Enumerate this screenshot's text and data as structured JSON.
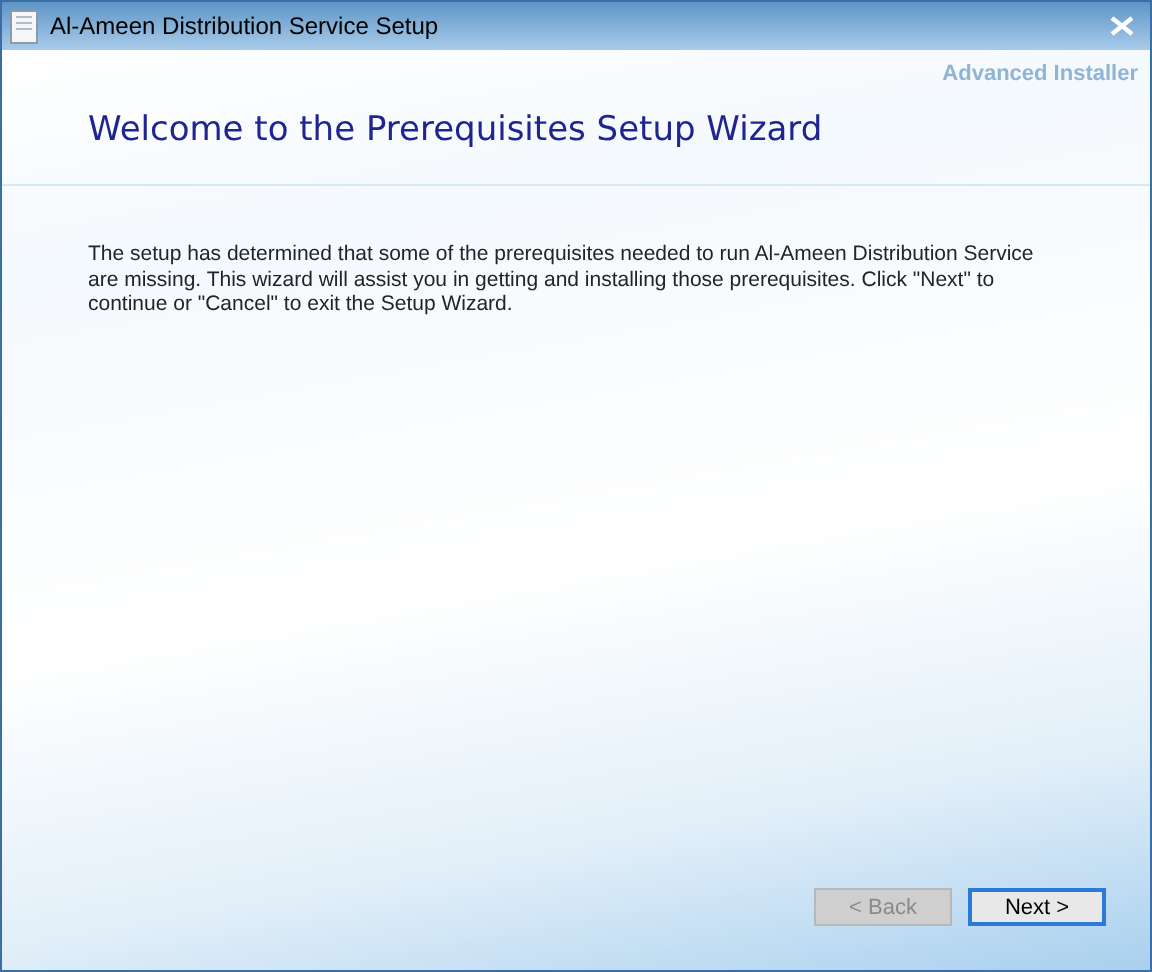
{
  "window": {
    "title": "Al-Ameen Distribution Service Setup"
  },
  "brand": "Advanced Installer",
  "heading": "Welcome to the Prerequisites Setup Wizard",
  "description": "The setup has determined that some of the prerequisites needed to run Al-Ameen Distribution Service are missing. This wizard will assist you in getting and installing those prerequisites. Click \"Next\" to continue or \"Cancel\" to exit the Setup Wizard.",
  "buttons": [
    {
      "label": "< Back",
      "disabled": true,
      "default": false
    },
    {
      "label": "Next >",
      "disabled": false,
      "default": true
    }
  ]
}
